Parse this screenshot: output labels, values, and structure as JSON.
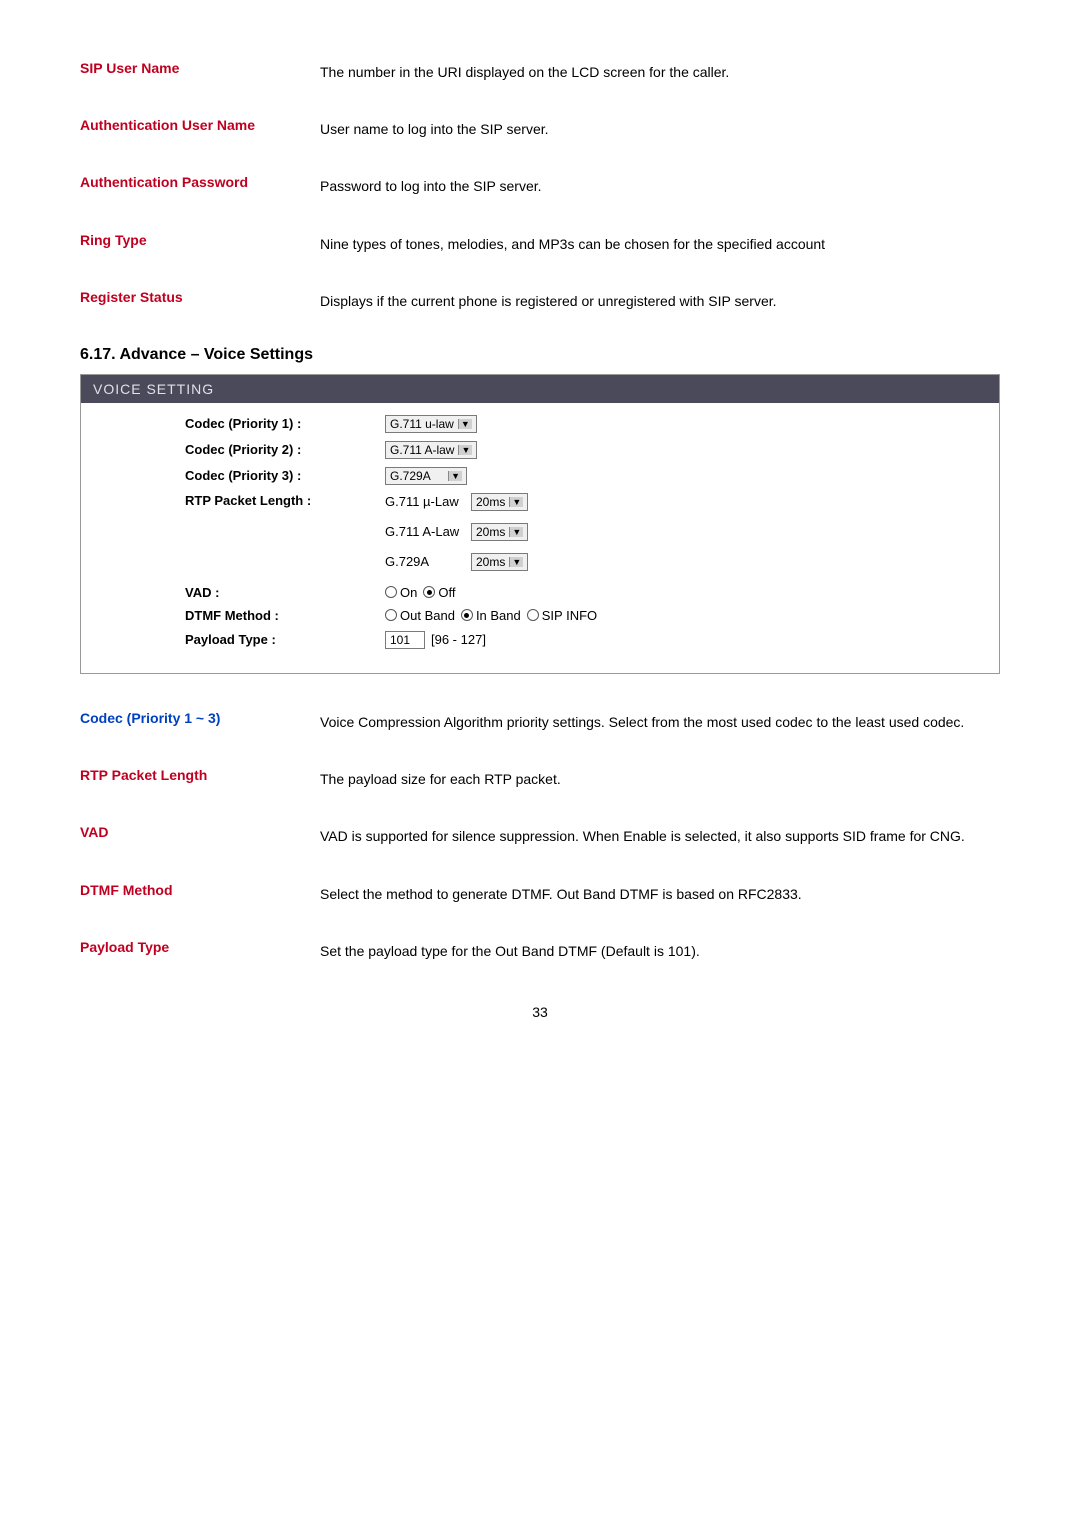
{
  "top_rows": [
    {
      "label": "SIP User Name",
      "desc": "The number in the URI displayed on the LCD screen for the caller."
    },
    {
      "label": "Authentication User Name",
      "desc": "User name to log into the SIP server."
    },
    {
      "label": "Authentication Password",
      "desc": "Password to log into the SIP server."
    },
    {
      "label": "Ring Type",
      "desc": "Nine types of tones, melodies, and MP3s can be chosen for the specified account"
    },
    {
      "label": "Register Status",
      "desc": "Displays if the current phone is registered or unregistered with SIP server."
    }
  ],
  "section_heading": "6.17. Advance – Voice Settings",
  "voice_panel": {
    "header": "VOICE SETTING",
    "codec1": {
      "label": "Codec (Priority 1) :",
      "value": "G.711 u-law"
    },
    "codec2": {
      "label": "Codec (Priority 2) :",
      "value": "G.711 A-law"
    },
    "codec3": {
      "label": "Codec (Priority 3) :",
      "value": "G.729A"
    },
    "rtp": {
      "label": "RTP Packet Length :",
      "items": [
        {
          "name": "G.711 µ-Law",
          "val": "20ms"
        },
        {
          "name": "G.711 A-Law",
          "val": "20ms"
        },
        {
          "name": "G.729A",
          "val": "20ms"
        }
      ]
    },
    "vad": {
      "label": "VAD :",
      "opt_on": "On",
      "opt_off": "Off",
      "selected": "off"
    },
    "dtmf": {
      "label": "DTMF Method :",
      "opt1": "Out Band",
      "opt2": "In Band",
      "opt3": "SIP INFO"
    },
    "payload": {
      "label": "Payload Type :",
      "value": "101",
      "range": "[96 - 127]"
    }
  },
  "bottom_rows": [
    {
      "label": "Codec (Priority 1 ~ 3)",
      "desc": "Voice Compression Algorithm priority settings. Select from the most used codec to the least used codec."
    },
    {
      "label": "RTP Packet Length",
      "desc": "The payload size for each RTP packet."
    },
    {
      "label": "VAD",
      "desc": "VAD is supported for silence suppression. When Enable is selected, it also supports SID frame for CNG."
    },
    {
      "label": "DTMF Method",
      "desc": "Select the method to generate DTMF. Out Band DTMF is based on RFC2833."
    },
    {
      "label": "Payload Type",
      "desc": "Set the payload type for the Out Band DTMF (Default is 101)."
    }
  ],
  "page_number": "33"
}
